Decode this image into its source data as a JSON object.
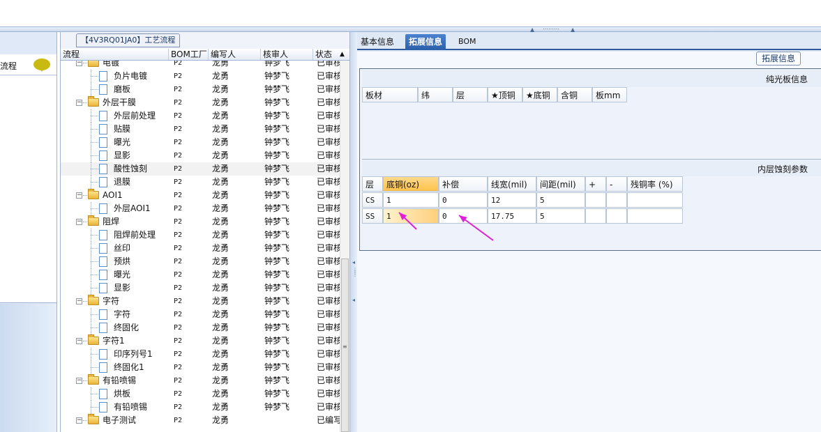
{
  "top": {
    "process_tab_label": "【4V3RQ01JA0】工艺流程",
    "splitter_grip": "⋯⋯⋯"
  },
  "leftnav": {
    "item_label": "流程",
    "chat_icon": "speech-bubble-icon",
    "chat_color": "#c9ba12"
  },
  "tree": {
    "headers": [
      "流程",
      "BOM工厂",
      "编写人",
      "核审人",
      "状态"
    ],
    "rows": [
      {
        "level": 0,
        "type": "folder",
        "name": "电镀",
        "bom": "P2",
        "author": "龙勇",
        "reviewer": "钟梦飞",
        "status": "已审核"
      },
      {
        "level": 1,
        "type": "doc",
        "name": "负片电镀",
        "bom": "P2",
        "author": "龙勇",
        "reviewer": "钟梦飞",
        "status": "已审核"
      },
      {
        "level": 1,
        "type": "doc",
        "name": "磨板",
        "bom": "P2",
        "author": "龙勇",
        "reviewer": "钟梦飞",
        "status": "已审核"
      },
      {
        "level": 0,
        "type": "folder",
        "name": "外层干膜",
        "bom": "P2",
        "author": "龙勇",
        "reviewer": "钟梦飞",
        "status": "已审核"
      },
      {
        "level": 1,
        "type": "doc",
        "name": "外层前处理",
        "bom": "P2",
        "author": "龙勇",
        "reviewer": "钟梦飞",
        "status": "已审核"
      },
      {
        "level": 1,
        "type": "doc",
        "name": "贴膜",
        "bom": "P2",
        "author": "龙勇",
        "reviewer": "钟梦飞",
        "status": "已审核"
      },
      {
        "level": 1,
        "type": "doc",
        "name": "曝光",
        "bom": "P2",
        "author": "龙勇",
        "reviewer": "钟梦飞",
        "status": "已审核"
      },
      {
        "level": 1,
        "type": "doc",
        "name": "显影",
        "bom": "P2",
        "author": "龙勇",
        "reviewer": "钟梦飞",
        "status": "已审核"
      },
      {
        "level": 1,
        "type": "doc",
        "name": "酸性蚀刻",
        "bom": "P2",
        "author": "龙勇",
        "reviewer": "钟梦飞",
        "status": "已审核",
        "selected": true
      },
      {
        "level": 1,
        "type": "doc",
        "name": "退膜",
        "bom": "P2",
        "author": "龙勇",
        "reviewer": "钟梦飞",
        "status": "已审核"
      },
      {
        "level": 0,
        "type": "folder",
        "name": "AOI1",
        "bom": "P2",
        "author": "龙勇",
        "reviewer": "钟梦飞",
        "status": "已审核"
      },
      {
        "level": 1,
        "type": "doc",
        "name": "外层AOI1",
        "bom": "P2",
        "author": "龙勇",
        "reviewer": "钟梦飞",
        "status": "已审核"
      },
      {
        "level": 0,
        "type": "folder",
        "name": "阻焊",
        "bom": "P2",
        "author": "龙勇",
        "reviewer": "钟梦飞",
        "status": "已审核"
      },
      {
        "level": 1,
        "type": "doc",
        "name": "阻焊前处理",
        "bom": "P2",
        "author": "龙勇",
        "reviewer": "钟梦飞",
        "status": "已审核"
      },
      {
        "level": 1,
        "type": "doc",
        "name": "丝印",
        "bom": "P2",
        "author": "龙勇",
        "reviewer": "钟梦飞",
        "status": "已审核"
      },
      {
        "level": 1,
        "type": "doc",
        "name": "预烘",
        "bom": "P2",
        "author": "龙勇",
        "reviewer": "钟梦飞",
        "status": "已审核"
      },
      {
        "level": 1,
        "type": "doc",
        "name": "曝光",
        "bom": "P2",
        "author": "龙勇",
        "reviewer": "钟梦飞",
        "status": "已审核"
      },
      {
        "level": 1,
        "type": "doc",
        "name": "显影",
        "bom": "P2",
        "author": "龙勇",
        "reviewer": "钟梦飞",
        "status": "已审核"
      },
      {
        "level": 0,
        "type": "folder",
        "name": "字符",
        "bom": "P2",
        "author": "龙勇",
        "reviewer": "钟梦飞",
        "status": "已审核"
      },
      {
        "level": 1,
        "type": "doc",
        "name": "字符",
        "bom": "P2",
        "author": "龙勇",
        "reviewer": "钟梦飞",
        "status": "已审核"
      },
      {
        "level": 1,
        "type": "doc",
        "name": "终固化",
        "bom": "P2",
        "author": "龙勇",
        "reviewer": "钟梦飞",
        "status": "已审核"
      },
      {
        "level": 0,
        "type": "folder",
        "name": "字符1",
        "bom": "P2",
        "author": "龙勇",
        "reviewer": "钟梦飞",
        "status": "已审核"
      },
      {
        "level": 1,
        "type": "doc",
        "name": "印序列号1",
        "bom": "P2",
        "author": "龙勇",
        "reviewer": "钟梦飞",
        "status": "已审核"
      },
      {
        "level": 1,
        "type": "doc",
        "name": "终固化1",
        "bom": "P2",
        "author": "龙勇",
        "reviewer": "钟梦飞",
        "status": "已审核"
      },
      {
        "level": 0,
        "type": "folder",
        "name": "有铅喷锡",
        "bom": "P2",
        "author": "龙勇",
        "reviewer": "钟梦飞",
        "status": "已审核"
      },
      {
        "level": 1,
        "type": "doc",
        "name": "烘板",
        "bom": "P2",
        "author": "龙勇",
        "reviewer": "钟梦飞",
        "status": "已审核"
      },
      {
        "level": 1,
        "type": "doc",
        "name": "有铅喷锡",
        "bom": "P2",
        "author": "龙勇",
        "reviewer": "钟梦飞",
        "status": "已审核"
      },
      {
        "level": 0,
        "type": "folder",
        "name": "电子测试",
        "bom": "P2",
        "author": "龙勇",
        "reviewer": "",
        "status": "已编写"
      }
    ]
  },
  "right": {
    "tabs": [
      "基本信息",
      "拓展信息",
      "BOM"
    ],
    "active_tab": "拓展信息",
    "panel_legend": "拓展信息",
    "plain_board": {
      "title": "纯光板信息",
      "headers": [
        "板材",
        "纬",
        "层",
        "★顶铜",
        "★底铜",
        "含铜",
        "板mm"
      ]
    },
    "inner_etch": {
      "title": "内层蚀刻参数",
      "headers": [
        "层",
        "底铜(oz)",
        "补偿",
        "线宽(mil)",
        "间距(mil)",
        "+",
        "-",
        "残铜率 (%)"
      ],
      "rows": [
        [
          "CS",
          "1",
          "0",
          "12",
          "5",
          "",
          "",
          ""
        ],
        [
          "SS",
          "1",
          "0",
          "17.75",
          "5",
          "",
          "",
          ""
        ]
      ]
    }
  },
  "annotation_color": "#e020d8"
}
